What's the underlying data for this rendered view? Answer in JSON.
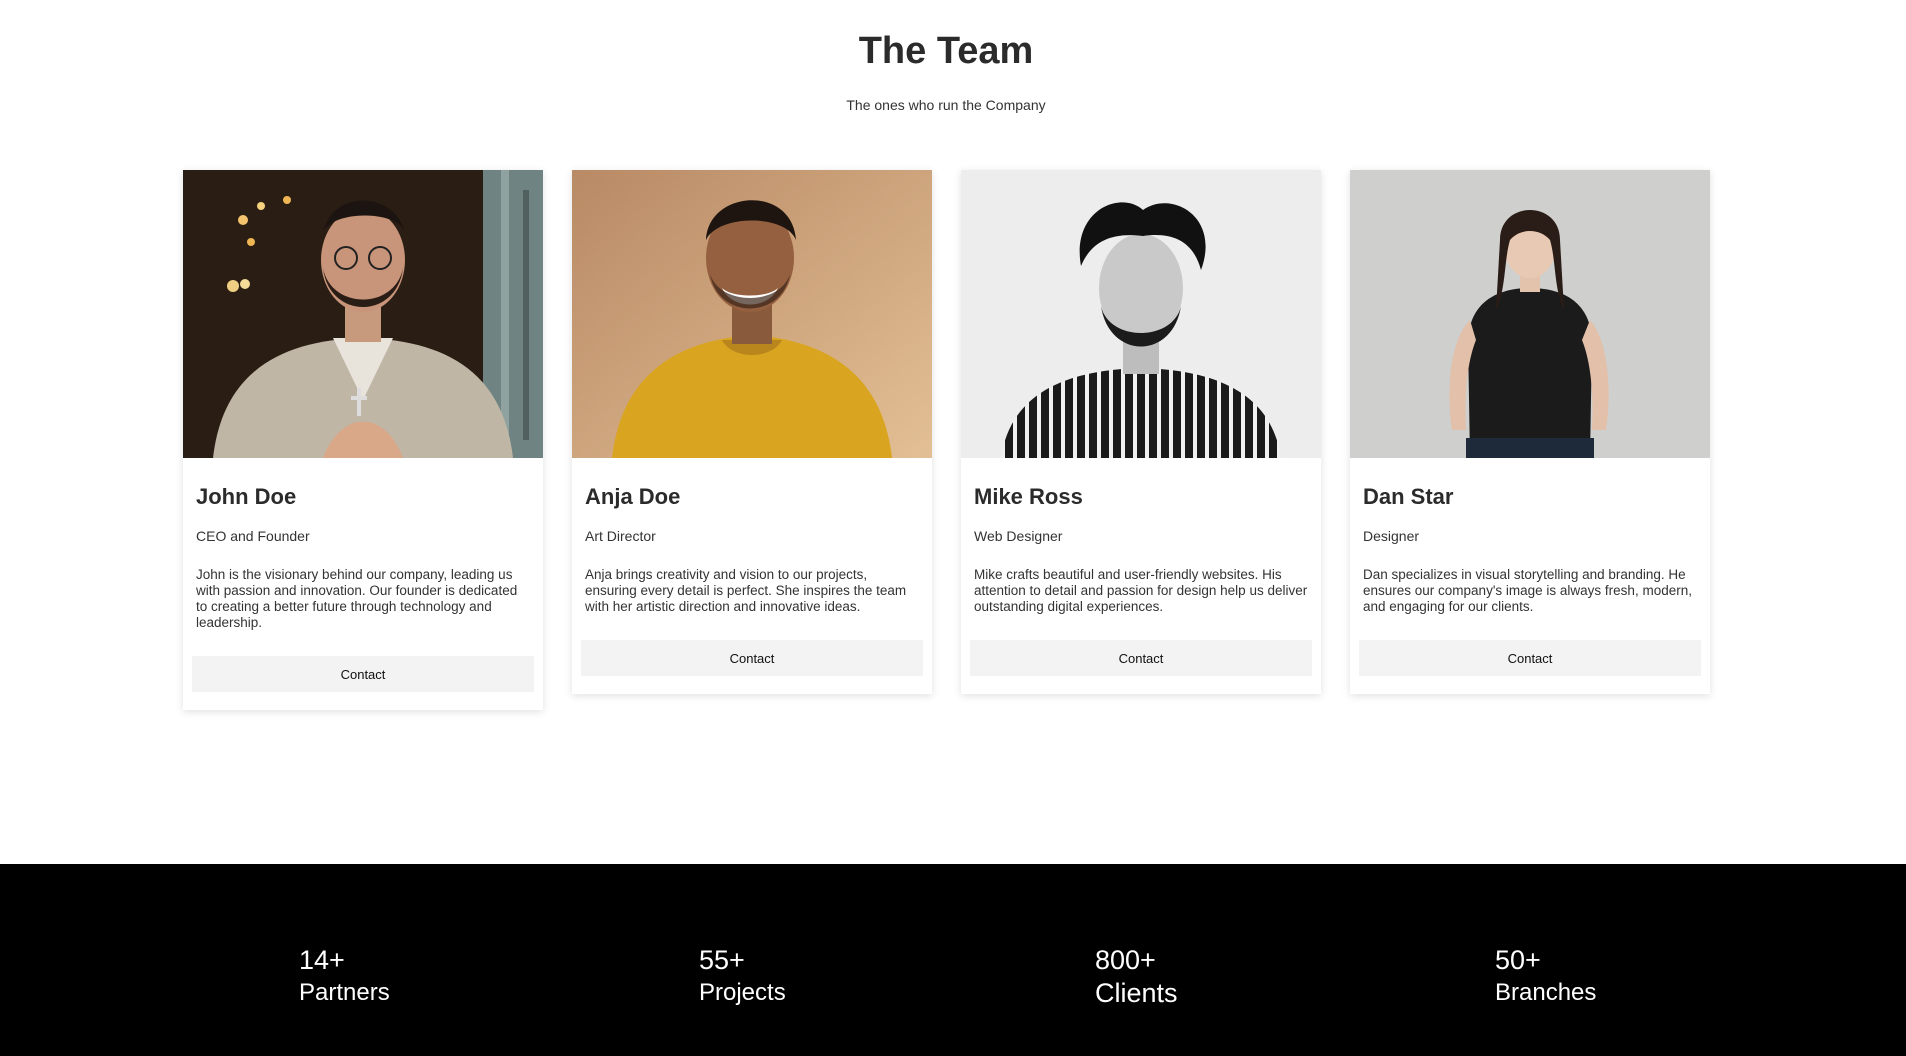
{
  "header": {
    "title": "The Team",
    "subtitle": "The ones who run the Company"
  },
  "team": [
    {
      "name": "John Doe",
      "role": "CEO and Founder",
      "bio": "John is the visionary behind our company, leading us with passion and innovation. Our founder is dedicated to creating a better future through technology and leadership.",
      "contact_label": "Contact"
    },
    {
      "name": "Anja Doe",
      "role": "Art Director",
      "bio": "Anja brings creativity and vision to our projects, ensuring every detail is perfect. She inspires the team with her artistic direction and innovative ideas.",
      "contact_label": "Contact"
    },
    {
      "name": "Mike Ross",
      "role": "Web Designer",
      "bio": "Mike crafts beautiful and user-friendly websites. His attention to detail and passion for design help us deliver outstanding digital experiences.",
      "contact_label": "Contact"
    },
    {
      "name": "Dan Star",
      "role": "Designer",
      "bio": "Dan specializes in visual storytelling and branding. He ensures our company's image is always fresh, modern, and engaging for our clients.",
      "contact_label": "Contact"
    }
  ],
  "stats": [
    {
      "number": "14+",
      "label": "Partners"
    },
    {
      "number": "55+",
      "label": "Projects"
    },
    {
      "number": "800+",
      "label": "Clients"
    },
    {
      "number": "50+",
      "label": "Branches"
    }
  ],
  "colors": {
    "stats_background": "#000000",
    "stats_text": "#ffffff",
    "button_background": "#f3f3f3"
  }
}
